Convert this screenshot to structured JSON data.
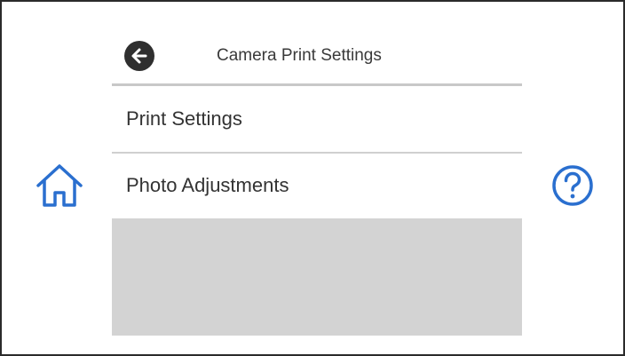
{
  "header": {
    "title": "Camera Print Settings",
    "back_icon": "arrow-left-circle-icon"
  },
  "menu": {
    "items": [
      {
        "label": "Print Settings"
      },
      {
        "label": "Photo Adjustments"
      }
    ]
  },
  "side_buttons": {
    "home_icon": "home-icon",
    "help_icon": "help-circle-icon"
  },
  "colors": {
    "icon_blue": "#2a6fcf",
    "back_button_bg": "#2f2f2f",
    "empty_area": "#d3d3d3",
    "text": "#333333"
  }
}
